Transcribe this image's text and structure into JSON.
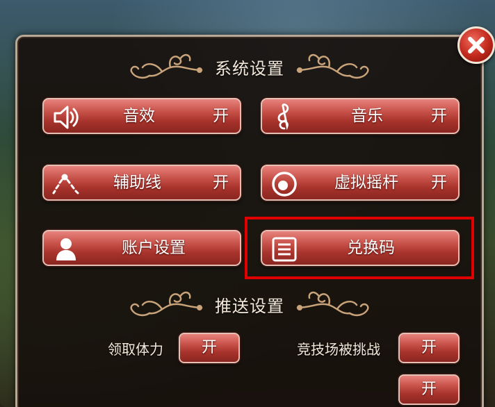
{
  "panel": {
    "close_icon": "close-icon",
    "system_title": "系统设置",
    "push_title": "推送设置"
  },
  "settings": [
    {
      "key": "sound",
      "label": "音效",
      "state": "开",
      "icon": "speaker-icon"
    },
    {
      "key": "music",
      "label": "音乐",
      "state": "开",
      "icon": "music-note-icon"
    },
    {
      "key": "guide_line",
      "label": "辅助线",
      "state": "开",
      "icon": "guide-line-icon"
    },
    {
      "key": "joystick",
      "label": "虚拟摇杆",
      "state": "开",
      "icon": "joystick-icon"
    },
    {
      "key": "account",
      "label": "账户设置",
      "icon": "user-icon"
    },
    {
      "key": "redeem",
      "label": "兑换码",
      "icon": "list-icon"
    }
  ],
  "push": [
    {
      "label": "领取体力",
      "state": "开"
    },
    {
      "label": "竞技场被挑战",
      "state": "开"
    },
    {
      "state": "开"
    }
  ],
  "colors": {
    "button_red": "#c9544c",
    "highlight": "#e00000",
    "panel_border": "#b8a898"
  }
}
